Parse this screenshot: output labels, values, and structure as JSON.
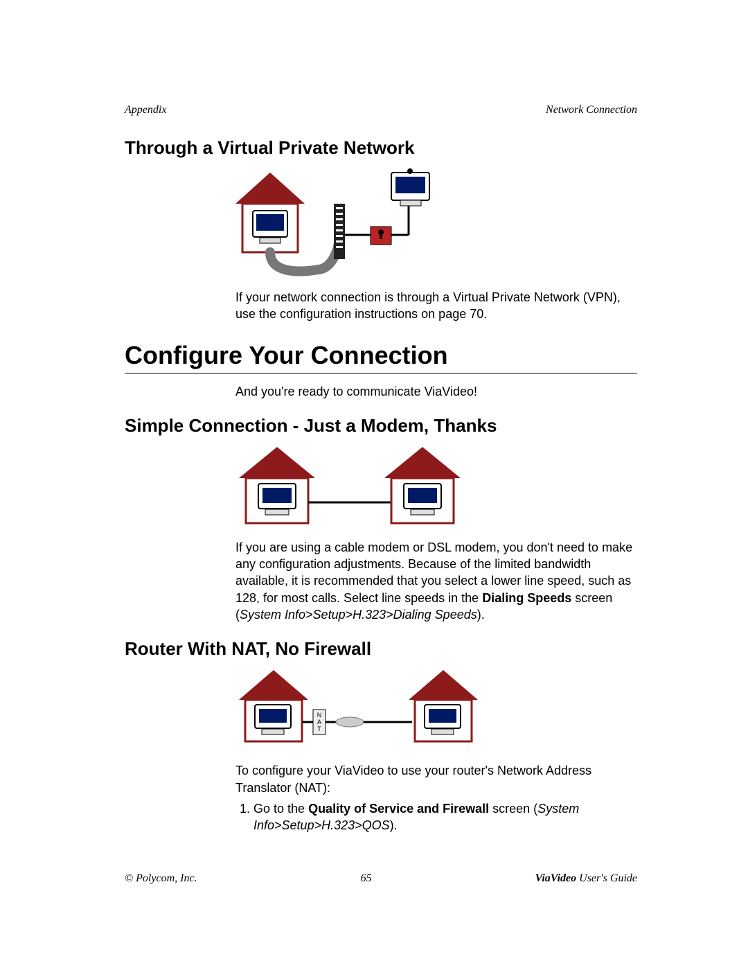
{
  "header": {
    "left": "Appendix",
    "right": "Network Connection"
  },
  "sections": {
    "vpn": {
      "heading": "Through a Virtual Private Network",
      "caption": "If your network connection is through a Virtual Private Network (VPN), use the configuration instructions on page 70."
    },
    "configure": {
      "heading": "Configure Your Connection",
      "intro": "And you're ready to communicate ViaVideo!"
    },
    "simple": {
      "heading": "Simple Connection - Just a Modem, Thanks",
      "para_pre": "If you are using a cable modem or DSL modem, you don't need to make any configuration adjustments. Because of the limited bandwidth available, it is recommended that you select a lower line speed, such as 128, for most calls. Select line speeds in the ",
      "bold1": "Dialing Speeds",
      "mid": " screen (",
      "italic": "System Info>Setup>H.323>Dialing Speeds",
      "post": ")."
    },
    "router": {
      "heading": "Router With NAT, No Firewall",
      "intro": "To configure your ViaVideo to use your router's Network Address Translator (NAT):",
      "step1_pre": "Go to the ",
      "step1_bold": "Quality of Service and Firewall",
      "step1_mid": " screen (",
      "step1_italic": "System Info>Setup>H.323>QOS",
      "step1_post": ")."
    }
  },
  "footer": {
    "left": "© Polycom, Inc.",
    "center": "65",
    "right_brand": "ViaVideo",
    "right_rest": " User's Guide"
  },
  "diagram_labels": {
    "nat": "N\nA\nT"
  }
}
